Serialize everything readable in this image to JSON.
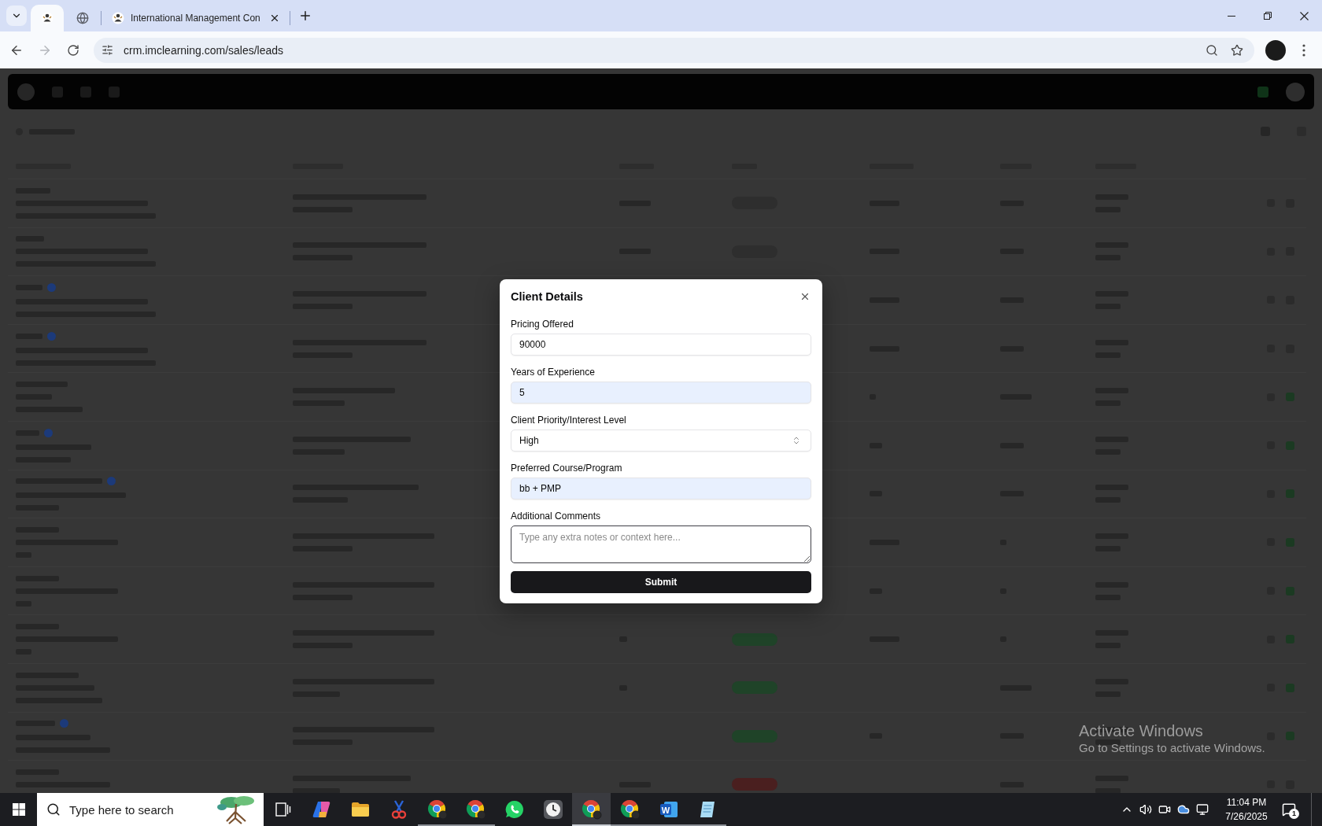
{
  "browser": {
    "tabs": [
      {
        "kind": "pinned-logo",
        "selected": true
      },
      {
        "kind": "pinned-globe",
        "selected": false
      },
      {
        "kind": "titled-logo",
        "title": "International Management Con",
        "selected": false
      }
    ],
    "nav": [
      {
        "kind": "back",
        "disabled": false
      },
      {
        "kind": "forward",
        "disabled": true
      },
      {
        "kind": "reload",
        "disabled": false
      }
    ],
    "address": "crm.imclearning.com/sales/leads"
  },
  "dialog": {
    "title": "Client Details",
    "fields": [
      {
        "kind": "input",
        "label": "Pricing Offered",
        "value": "90000",
        "autofilled": false
      },
      {
        "kind": "input",
        "label": "Years of Experience",
        "value": "5",
        "autofilled": true
      },
      {
        "kind": "select",
        "label": "Client Priority/Interest Level",
        "value": "High"
      },
      {
        "kind": "input",
        "label": "Preferred Course/Program",
        "value": "bb + PMP",
        "autofilled": true
      },
      {
        "kind": "textarea",
        "label": "Additional Comments",
        "placeholder": "Type any extra notes or context here...",
        "focused": true
      }
    ],
    "submit": "Submit"
  },
  "os_notice": {
    "title": "Activate Windows",
    "subtitle": "Go to Settings to activate Windows."
  },
  "taskbar": {
    "search_placeholder": "Type here to search",
    "apps": [
      {
        "kind": "task-view",
        "running": false,
        "selected": false
      },
      {
        "kind": "assistant",
        "running": false,
        "selected": false
      },
      {
        "kind": "folder",
        "running": false,
        "selected": false
      },
      {
        "kind": "scissors",
        "running": false,
        "selected": false
      },
      {
        "kind": "browser",
        "running": true,
        "selected": false
      },
      {
        "kind": "browser",
        "running": true,
        "selected": false
      },
      {
        "kind": "chat",
        "running": false,
        "selected": false
      },
      {
        "kind": "clock",
        "running": false,
        "selected": false
      },
      {
        "kind": "browser",
        "running": true,
        "selected": true
      },
      {
        "kind": "browser",
        "running": true,
        "selected": false
      },
      {
        "kind": "word",
        "glyph": "W",
        "running": true,
        "selected": false
      },
      {
        "kind": "notepad",
        "running": true,
        "selected": false
      }
    ],
    "tray": [
      {
        "kind": "chevron-up"
      },
      {
        "kind": "speaker"
      },
      {
        "kind": "camera"
      },
      {
        "kind": "cloud"
      },
      {
        "kind": "network"
      }
    ],
    "time": "11:04 PM",
    "date": "7/26/2025",
    "notifications": "1"
  }
}
